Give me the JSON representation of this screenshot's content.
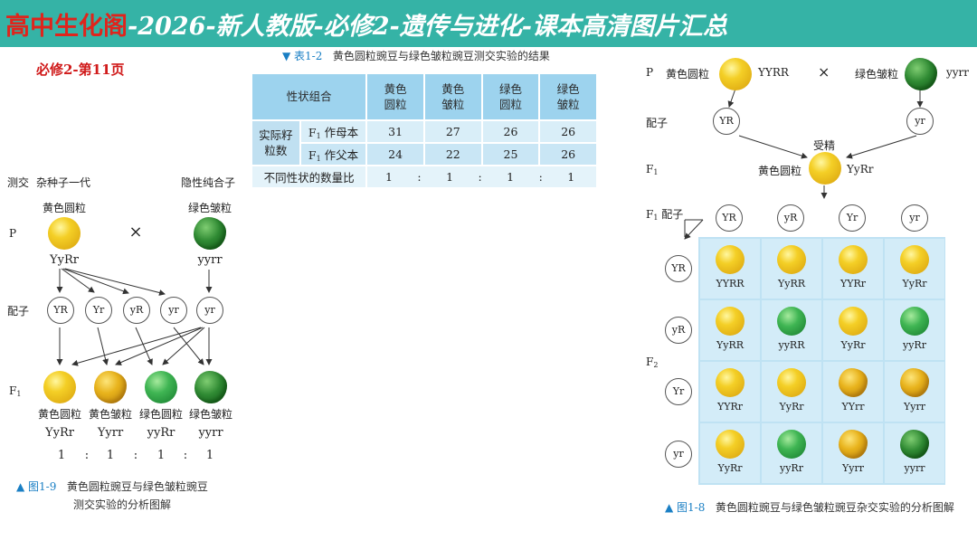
{
  "banner": {
    "red": "高中生化阁",
    "white": "-2026-新人教版-必修2-遗传与进化-课本高清图片汇总"
  },
  "page_label": "必修2-第11页",
  "table12": {
    "caption_num": "▼ 表1-2",
    "caption_text": "黄色圆粒豌豆与绿色皱粒豌豆测交实验的结果",
    "header_label": "性状组合",
    "col1a": "黄色",
    "col1b": "圆粒",
    "col2a": "黄色",
    "col2b": "皱粒",
    "col3a": "绿色",
    "col3b": "圆粒",
    "col4a": "绿色",
    "col4b": "皱粒",
    "side_a": "实际籽",
    "side_b": "粒数",
    "row1_label_pre": "F",
    "row1_label_sub": "1",
    "row1_label_post": " 作母本",
    "row1": [
      "31",
      "27",
      "26",
      "26"
    ],
    "row2_label_pre": "F",
    "row2_label_sub": "1",
    "row2_label_post": " 作父本",
    "row2": [
      "24",
      "22",
      "25",
      "26"
    ],
    "row3_label": "不同性状的数量比",
    "ratio": [
      "1",
      ":",
      "1",
      ":",
      "1",
      ":",
      "1"
    ]
  },
  "fig19": {
    "testcross": "测交",
    "hybrid": "杂种子一代",
    "recessive": "隐性纯合子",
    "p_left_name": "黄色圆粒",
    "p_right_name": "绿色皱粒",
    "p_label": "P",
    "cross": "×",
    "p_left_geno": "YyRr",
    "p_right_geno": "yyrr",
    "gamete_label": "配子",
    "gametes_left": [
      "YR",
      "Yr",
      "yR",
      "yr"
    ],
    "gamete_right": "yr",
    "f1_label_pre": "F",
    "f1_label_sub": "1",
    "offspring_names": [
      "黄色圆粒",
      "黄色皱粒",
      "绿色圆粒",
      "绿色皱粒"
    ],
    "offspring_genos": [
      "YyRr",
      "Yyrr",
      "yyRr",
      "yyrr"
    ],
    "ratio": [
      "1",
      ":",
      "1",
      ":",
      "1",
      ":",
      "1"
    ],
    "caption_num": "▲ 图1-9",
    "caption_line1": "黄色圆粒豌豆与绿色皱粒豌豆",
    "caption_line2": "测交实验的分析图解"
  },
  "fig18": {
    "p_label": "P",
    "p_left_name": "黄色圆粒",
    "p_left_geno": "YYRR",
    "cross": "×",
    "p_right_name": "绿色皱粒",
    "p_right_geno": "yyrr",
    "gamete_label": "配子",
    "gamete_left": "YR",
    "gamete_right": "yr",
    "fert": "受精",
    "f1_label_pre": "F",
    "f1_label_sub": "1",
    "f1_name": "黄色圆粒",
    "f1_geno": "YyRr",
    "f1_gamete_label_pre": "F",
    "f1_gamete_label_sub": "1",
    "f1_gamete_label_post": " 配子",
    "cols": [
      "YR",
      "yR",
      "Yr",
      "yr"
    ],
    "rows": [
      "YR",
      "yR",
      "Yr",
      "yr"
    ],
    "f2_label_pre": "F",
    "f2_label_sub": "2",
    "grid_genos": [
      [
        "YYRR",
        "YyRR",
        "YYRr",
        "YyRr"
      ],
      [
        "YyRR",
        "yyRR",
        "YyRr",
        "yyRr"
      ],
      [
        "YYRr",
        "YyRr",
        "YYrr",
        "Yyrr"
      ],
      [
        "YyRr",
        "yyRr",
        "Yyrr",
        "yyrr"
      ]
    ],
    "caption_num": "▲ 图1-8",
    "caption_text": "黄色圆粒豌豆与绿色皱粒豌豆杂交实验的分析图解"
  }
}
